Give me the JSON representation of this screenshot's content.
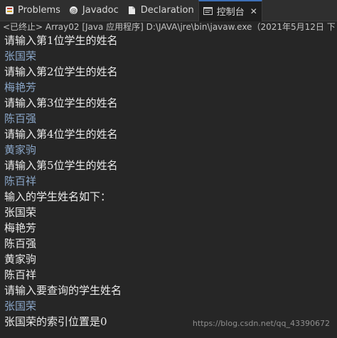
{
  "tabs": [
    {
      "label": "Problems",
      "icon": "problems-icon"
    },
    {
      "label": "Javadoc",
      "icon": "javadoc-icon"
    },
    {
      "label": "Declaration",
      "icon": "declaration-icon"
    },
    {
      "label": "控制台",
      "icon": "console-icon",
      "active": true,
      "close": "✕"
    }
  ],
  "status_line": "<已终止> Array02 [Java 应用程序] D:\\JAVA\\jre\\bin\\javaw.exe（2021年5月12日 下",
  "console_lines": [
    {
      "text": "请输入第1位学生的姓名",
      "kind": "out"
    },
    {
      "text": "张国荣",
      "kind": "in"
    },
    {
      "text": "请输入第2位学生的姓名",
      "kind": "out"
    },
    {
      "text": "梅艳芳",
      "kind": "in"
    },
    {
      "text": "请输入第3位学生的姓名",
      "kind": "out"
    },
    {
      "text": "陈百强",
      "kind": "in"
    },
    {
      "text": "请输入第4位学生的姓名",
      "kind": "out"
    },
    {
      "text": "黄家驹",
      "kind": "in"
    },
    {
      "text": "请输入第5位学生的姓名",
      "kind": "out"
    },
    {
      "text": "陈百祥",
      "kind": "in"
    },
    {
      "text": "输入的学生姓名如下：",
      "kind": "out"
    },
    {
      "text": "张国荣",
      "kind": "out"
    },
    {
      "text": "梅艳芳",
      "kind": "out"
    },
    {
      "text": "陈百强",
      "kind": "out"
    },
    {
      "text": "黄家驹",
      "kind": "out"
    },
    {
      "text": "陈百祥",
      "kind": "out"
    },
    {
      "text": "请输入要查询的学生姓名",
      "kind": "out"
    },
    {
      "text": "张国荣",
      "kind": "in"
    },
    {
      "text": "张国荣的索引位置是0",
      "kind": "out"
    }
  ],
  "watermark": "https://blog.csdn.net/qq_43390672",
  "colors": {
    "background": "#262626",
    "stdout_text": "#ebebeb",
    "stdin_text": "#8aa6c8",
    "active_tab_accent": "#3d6fb6"
  }
}
